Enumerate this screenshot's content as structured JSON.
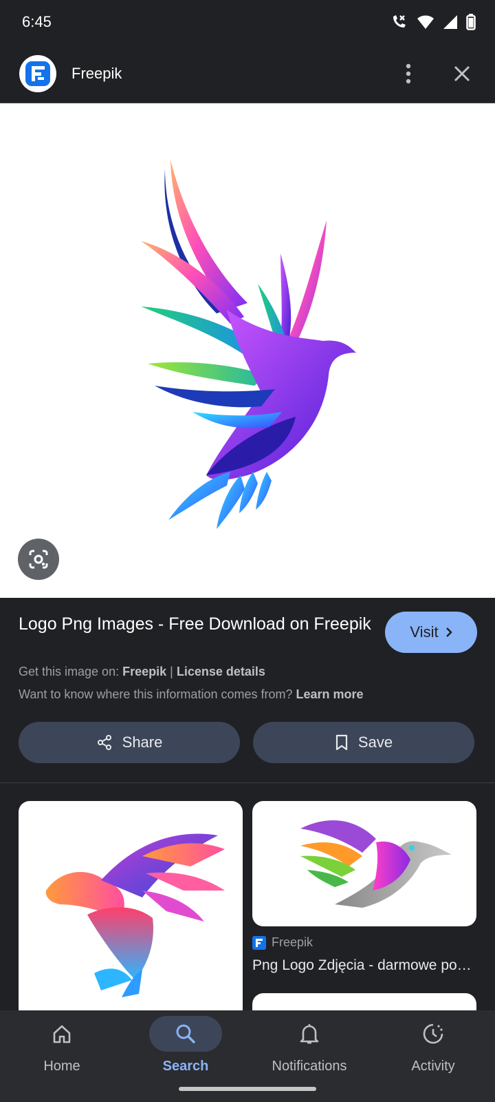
{
  "status_bar": {
    "time": "6:45",
    "icons": [
      "wifi-calling-icon",
      "wifi-icon",
      "signal-icon",
      "battery-icon"
    ]
  },
  "header": {
    "site_name": "Freepik",
    "logo_icon": "freepik-logo-icon",
    "menu_icon": "more-vert-icon",
    "close_icon": "close-icon"
  },
  "result": {
    "title": "Logo Png Images - Free Download on Freepik",
    "visit_label": "Visit",
    "get_image_prefix": "Get this image on:",
    "source_link": "Freepik",
    "separator": "|",
    "license_link": "License details",
    "info_question": "Want to know where this information comes from?",
    "learn_more": "Learn more",
    "share_label": "Share",
    "save_label": "Save"
  },
  "related": [
    {
      "source": "",
      "title": ""
    },
    {
      "source": "Freepik",
      "title": "Png Logo Zdjęcia - darmowe pobieranie na Freepik"
    }
  ],
  "bottom_nav": {
    "items": [
      {
        "label": "Home",
        "icon": "home-icon"
      },
      {
        "label": "Search",
        "icon": "search-icon"
      },
      {
        "label": "Notifications",
        "icon": "bell-icon"
      },
      {
        "label": "Activity",
        "icon": "history-icon"
      }
    ],
    "active": "Search"
  },
  "colors": {
    "background": "#202124",
    "accent": "#8ab4f8",
    "chip": "#3c4658",
    "nav": "#2b2c30"
  }
}
